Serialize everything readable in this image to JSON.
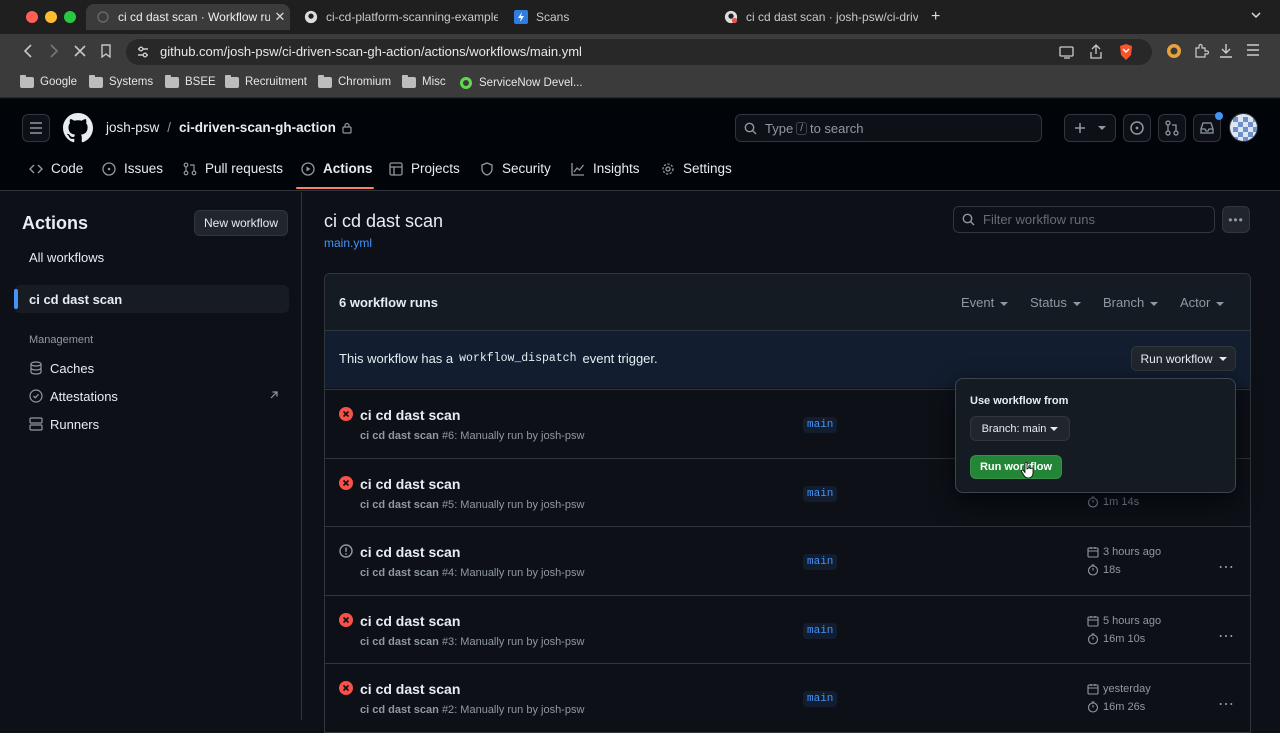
{
  "browser": {
    "tabs": [
      {
        "title": "ci cd dast scan · Workflow runs",
        "active": true
      },
      {
        "title": "ci-cd-platform-scanning-example",
        "active": false
      },
      {
        "title": "Scans",
        "active": false
      },
      {
        "title": "ci cd dast scan · josh-psw/ci-driven",
        "active": false
      }
    ],
    "url": "github.com/josh-psw/ci-driven-scan-gh-action/actions/workflows/main.yml",
    "bookmarks": [
      "Google",
      "Systems",
      "BSEE",
      "Recruitment",
      "Chromium",
      "Misc",
      "ServiceNow Devel..."
    ]
  },
  "header": {
    "owner": "josh-psw",
    "separator": "/",
    "repo": "ci-driven-scan-gh-action",
    "search_placeholder_pre": "Type",
    "search_key": "/",
    "search_placeholder_post": "to search"
  },
  "nav": {
    "tabs": [
      {
        "label": "Code",
        "icon": "code-icon"
      },
      {
        "label": "Issues",
        "icon": "issue-icon"
      },
      {
        "label": "Pull requests",
        "icon": "pull-request-icon"
      },
      {
        "label": "Actions",
        "icon": "play-icon",
        "active": true
      },
      {
        "label": "Projects",
        "icon": "table-icon"
      },
      {
        "label": "Security",
        "icon": "shield-icon"
      },
      {
        "label": "Insights",
        "icon": "graph-icon"
      },
      {
        "label": "Settings",
        "icon": "gear-icon"
      }
    ]
  },
  "sidebar": {
    "title": "Actions",
    "new_workflow": "New workflow",
    "all_workflows": "All workflows",
    "selected_workflow": "ci cd dast scan",
    "management_heading": "Management",
    "management_items": [
      {
        "label": "Caches",
        "icon": "database-icon"
      },
      {
        "label": "Attestations",
        "icon": "verified-icon"
      },
      {
        "label": "Runners",
        "icon": "server-icon"
      }
    ]
  },
  "main": {
    "title": "ci cd dast scan",
    "file_link": "main.yml",
    "filter_placeholder": "Filter workflow runs",
    "runs_count": "6 workflow runs",
    "filters": [
      "Event",
      "Status",
      "Branch",
      "Actor"
    ],
    "dispatch_pre": "This workflow has a",
    "dispatch_code": "workflow_dispatch",
    "dispatch_post": "event trigger.",
    "run_workflow_button": "Run workflow"
  },
  "popover": {
    "heading": "Use workflow from",
    "branch_button": "Branch: main",
    "run_button": "Run workflow"
  },
  "runs": [
    {
      "title": "ci cd dast scan",
      "workflow": "ci cd dast scan",
      "number": "#6",
      "trigger": ": Manually run by josh-psw",
      "branch": "main",
      "status": "failed",
      "when": "",
      "duration": ""
    },
    {
      "title": "ci cd dast scan",
      "workflow": "ci cd dast scan",
      "number": "#5",
      "trigger": ": Manually run by josh-psw",
      "branch": "main",
      "status": "failed",
      "when": "",
      "duration": "1m 14s"
    },
    {
      "title": "ci cd dast scan",
      "workflow": "ci cd dast scan",
      "number": "#4",
      "trigger": ": Manually run by josh-psw",
      "branch": "main",
      "status": "cancelled",
      "when": "3 hours ago",
      "duration": "18s"
    },
    {
      "title": "ci cd dast scan",
      "workflow": "ci cd dast scan",
      "number": "#3",
      "trigger": ": Manually run by josh-psw",
      "branch": "main",
      "status": "failed",
      "when": "5 hours ago",
      "duration": "16m 10s"
    },
    {
      "title": "ci cd dast scan",
      "workflow": "ci cd dast scan",
      "number": "#2",
      "trigger": ": Manually run by josh-psw",
      "branch": "main",
      "status": "failed",
      "when": "yesterday",
      "duration": "16m 26s"
    }
  ],
  "colors": {
    "accent_blue": "#4493f8",
    "failed_red": "#f85149",
    "success_green": "#238636",
    "active_tab_underline": "#f78166"
  }
}
